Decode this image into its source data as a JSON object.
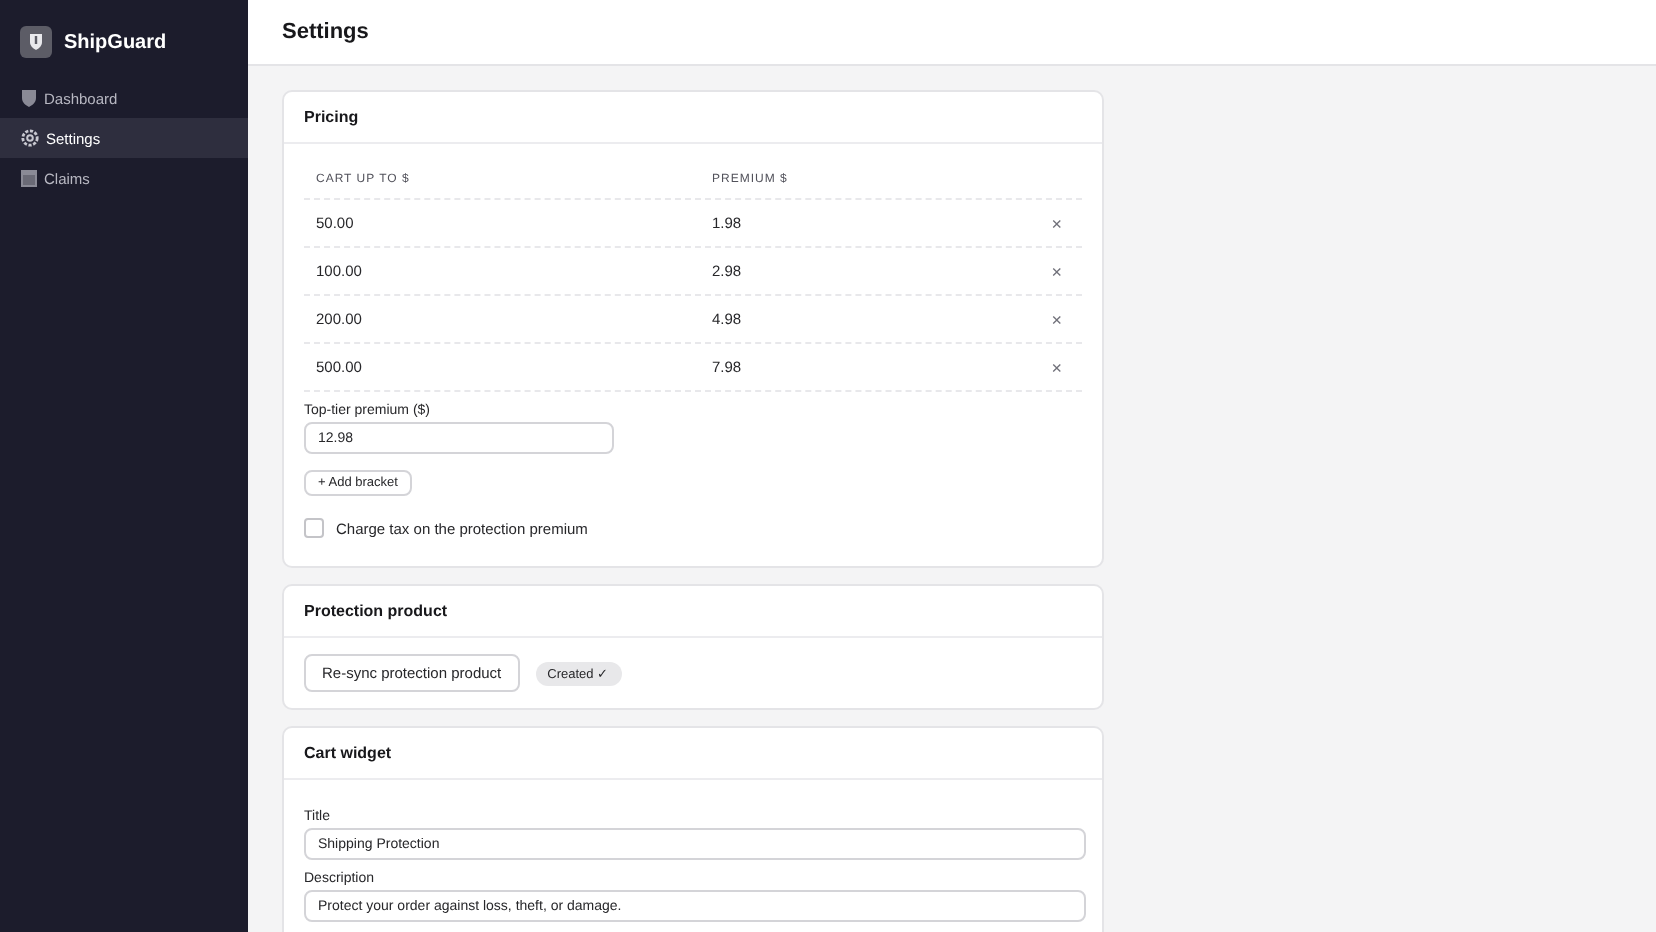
{
  "app": {
    "name": "ShipGuard"
  },
  "sidebar": {
    "items": [
      {
        "label": "Dashboard",
        "selected": false
      },
      {
        "label": "Settings",
        "selected": true
      },
      {
        "label": "Claims",
        "selected": false
      }
    ]
  },
  "page": {
    "title": "Settings"
  },
  "pricing": {
    "title": "Pricing",
    "columns": [
      "CART UP TO $",
      "PREMIUM $"
    ],
    "rows": [
      {
        "cart": "50.00",
        "premium": "1.98",
        "remove": "×"
      },
      {
        "cart": "100.00",
        "premium": "2.98",
        "remove": "×"
      },
      {
        "cart": "200.00",
        "premium": "4.98",
        "remove": "×"
      },
      {
        "cart": "500.00",
        "premium": "7.98",
        "remove": "×"
      }
    ],
    "top_tier": {
      "label": "Top-tier premium ($)",
      "value": "12.98"
    },
    "add_button": "+ Add bracket",
    "tax": {
      "label": "Charge tax on the protection premium",
      "checked": false
    }
  },
  "protection_product": {
    "title": "Protection product",
    "button": "Re-sync protection product",
    "status": "Created ✓"
  },
  "cart_widget": {
    "title": "Cart widget",
    "fields": [
      {
        "label": "Title",
        "value": "Shipping Protection"
      },
      {
        "label": "Description",
        "value": "Protect your order against loss, theft, or damage."
      }
    ]
  }
}
